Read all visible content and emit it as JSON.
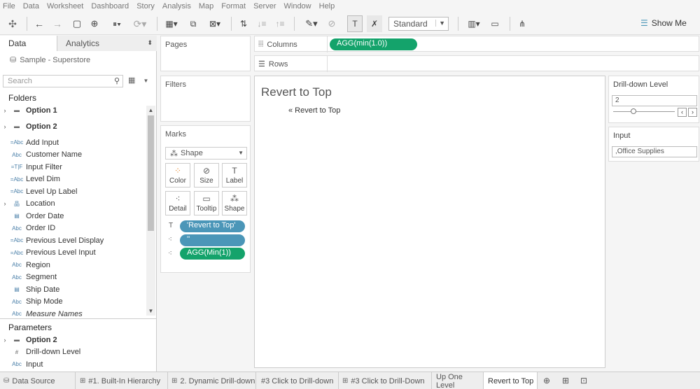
{
  "menu": [
    "File",
    "Data",
    "Worksheet",
    "Dashboard",
    "Story",
    "Analysis",
    "Map",
    "Format",
    "Server",
    "Window",
    "Help"
  ],
  "toolbar": {
    "fit_select": "Standard",
    "show_me": "Show Me",
    "icons": [
      "tableau-logo-icon",
      "undo-icon",
      "redo-icon",
      "save-icon",
      "new-datasource-icon",
      "pause-updates-icon",
      "refresh-icon",
      "new-worksheet-icon",
      "duplicate-sheet-icon",
      "clear-sheet-icon",
      "swap-icon",
      "sort-ascending-icon",
      "sort-descending-icon",
      "highlight-icon",
      "group-icon",
      "show-labels-icon",
      "fix-axes-icon",
      "chart-icon",
      "presentation-icon",
      "share-icon"
    ]
  },
  "left": {
    "tabs": {
      "data": "Data",
      "analytics": "Analytics"
    },
    "datasource": "Sample - Superstore",
    "search_placeholder": "Search",
    "folders_header": "Folders",
    "folders": [
      {
        "name": "Option 1",
        "type": "folder",
        "expandable": true
      },
      {
        "name": "Option 2",
        "type": "folder",
        "expandable": true
      },
      {
        "name": "Add Input",
        "type": "=Abc"
      },
      {
        "name": "Customer Name",
        "type": "Abc"
      },
      {
        "name": "Input Filter",
        "type": "=T|F"
      },
      {
        "name": "Level Dim",
        "type": "=Abc"
      },
      {
        "name": "Level Up Label",
        "type": "=Abc"
      },
      {
        "name": "Location",
        "type": "hierarchy",
        "expandable": true
      },
      {
        "name": "Order Date",
        "type": "date"
      },
      {
        "name": "Order ID",
        "type": "Abc"
      },
      {
        "name": "Previous Level Display",
        "type": "=Abc"
      },
      {
        "name": "Previous Level Input",
        "type": "=Abc"
      },
      {
        "name": "Region",
        "type": "Abc"
      },
      {
        "name": "Segment",
        "type": "Abc"
      },
      {
        "name": "Ship Date",
        "type": "date"
      },
      {
        "name": "Ship Mode",
        "type": "Abc"
      },
      {
        "name": "Measure Names",
        "type": "Abc",
        "italic": true
      }
    ],
    "parameters_header": "Parameters",
    "parameters": [
      {
        "name": "Option 2",
        "type": "folder",
        "expandable": true
      },
      {
        "name": "Drill-down Level",
        "type": "#"
      },
      {
        "name": "Input",
        "type": "Abc"
      }
    ]
  },
  "shelves": {
    "pages": "Pages",
    "filters": "Filters",
    "marks": "Marks",
    "mark_type": "Shape",
    "mark_buttons": [
      "Color",
      "Size",
      "Label",
      "Detail",
      "Tooltip",
      "Shape"
    ],
    "mark_pills": [
      {
        "text": "'Revert to Top'",
        "color": "blue",
        "icon": "text-icon"
      },
      {
        "text": "''",
        "color": "blue",
        "icon": "detail-icon"
      },
      {
        "text": "AGG(Min(1))",
        "color": "green",
        "icon": "detail-icon"
      }
    ],
    "columns_label": "Columns",
    "rows_label": "Rows",
    "columns_pill": "AGG(min(1.0))"
  },
  "canvas": {
    "title": "Revert to Top",
    "link": "« Revert to Top"
  },
  "right": {
    "drill_title": "Drill-down Level",
    "drill_value": "2",
    "input_title": "Input",
    "input_value": ",Office Supplies"
  },
  "tabs": [
    {
      "label": "Data Source",
      "icon": "datasource-icon"
    },
    {
      "label": "#1. Built-In Hierarchy",
      "icon": "sheet-icon"
    },
    {
      "label": "2. Dynamic Drill-down",
      "icon": "sheet-icon"
    },
    {
      "label": "#3 Click to Drill-down",
      "icon": ""
    },
    {
      "label": "#3 Click to Drill-Down",
      "icon": "sheet-icon"
    },
    {
      "label": "Up One Level",
      "icon": ""
    },
    {
      "label": "Revert to Top",
      "icon": "",
      "active": true
    }
  ]
}
